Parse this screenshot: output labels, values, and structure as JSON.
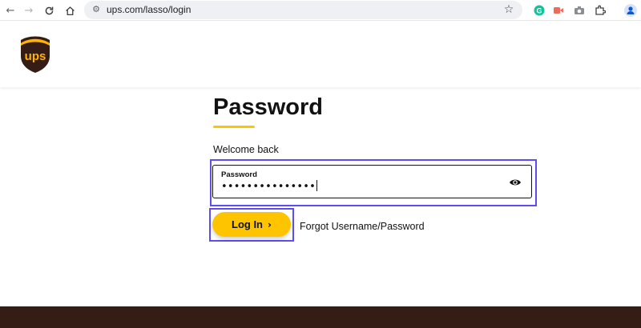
{
  "browser": {
    "url": "ups.com/lasso/login",
    "icons": [
      "back-arrow-icon",
      "forward-arrow-icon",
      "reload-icon",
      "home-icon",
      "site-settings-icon",
      "bookmark-star-icon",
      "grammarly-icon",
      "video-extension-icon",
      "screenshot-camera-icon",
      "extensions-puzzle-icon",
      "profile-icon"
    ]
  },
  "brand": {
    "logo_text": "ups",
    "brown": "#351c15",
    "gold": "#ffc400"
  },
  "login": {
    "title": "Password",
    "welcome": "Welcome back",
    "password_label": "Password",
    "password_value": "•••••••••••••••",
    "login_button": "Log In",
    "forgot_link": "Forgot Username/Password"
  },
  "highlight_color": "#5b4cf5"
}
